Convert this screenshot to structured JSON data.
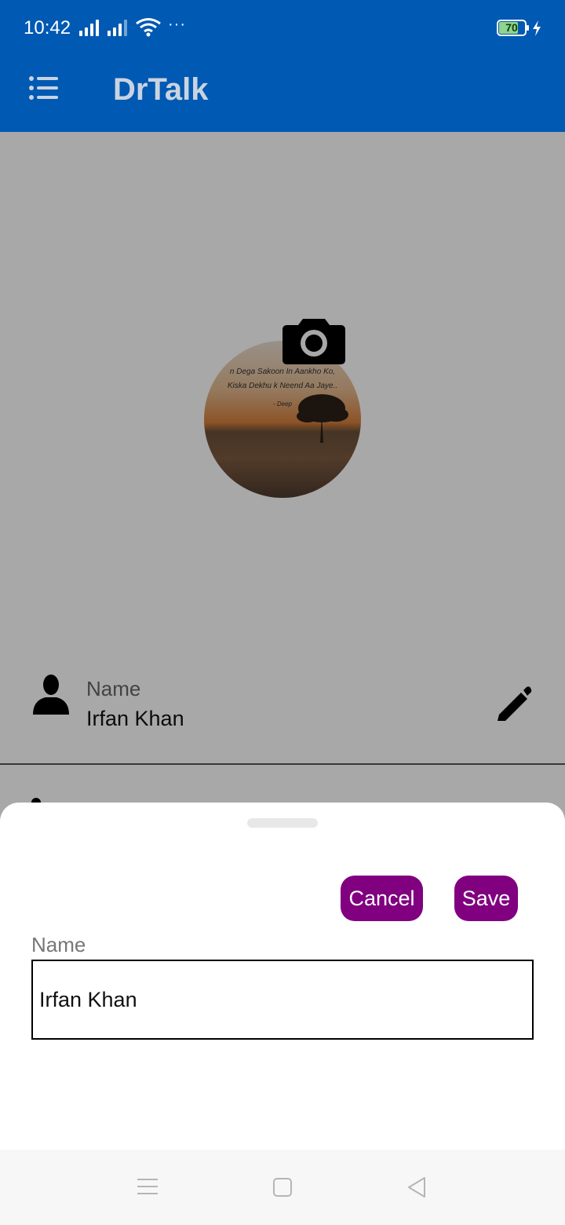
{
  "status_bar": {
    "time": "10:42",
    "battery_level": "70",
    "battery_fraction": 0.7,
    "more_indicator": "···"
  },
  "app_bar": {
    "title": "DrTalk",
    "menu_icon": "list-menu-icon"
  },
  "profile": {
    "avatar_quote_line1": "n Dega Sakoon In Aankho Ko,",
    "avatar_quote_line2": "Kiska Dekhu k Neend Aa Jaye..",
    "avatar_quote_author": "- Deep",
    "camera_icon": "camera-icon",
    "name_label": "Name",
    "name_value": "Irfan Khan",
    "edit_icon": "pencil-icon"
  },
  "sheet": {
    "cancel_label": "Cancel",
    "save_label": "Save",
    "field_label": "Name",
    "field_value": "Irfan Khan"
  },
  "colors": {
    "primary": "#0059b3",
    "button": "#800080"
  }
}
